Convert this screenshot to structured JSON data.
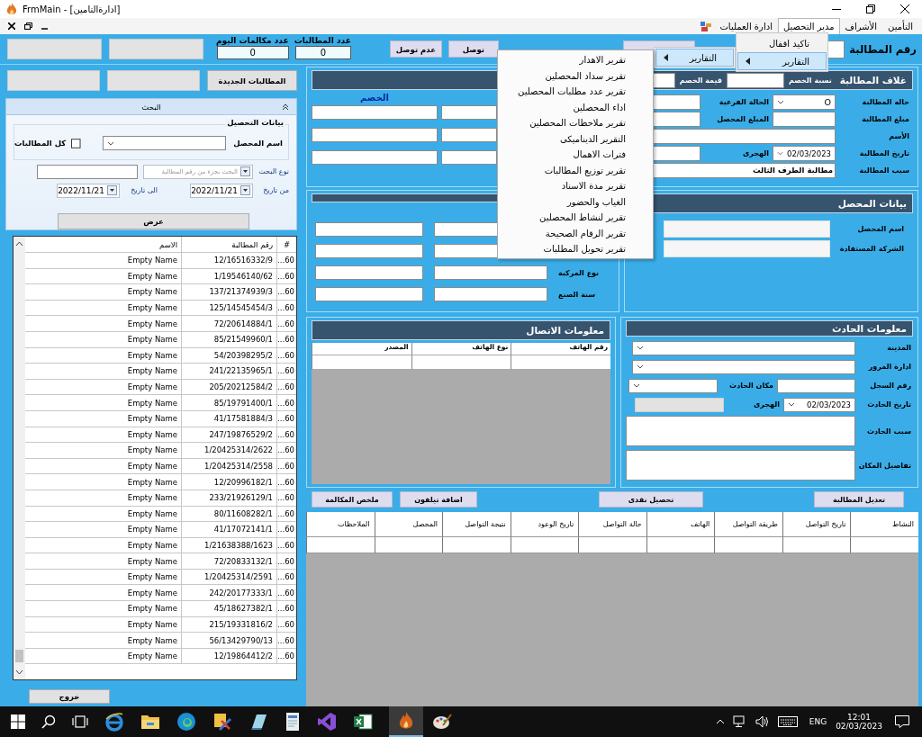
{
  "window": {
    "title": "FrmMain - [ادارةالتامين]"
  },
  "menu_bar": [
    {
      "label": "التأمين",
      "selected": false
    },
    {
      "label": "الأشراف",
      "selected": false
    },
    {
      "label": "مدير التحصيل",
      "selected": true
    },
    {
      "label": "ادارة العمليات",
      "selected": false
    }
  ],
  "dropdown": [
    {
      "label": "تاكيد اقفال",
      "selected": false,
      "submenu": false
    },
    {
      "label": "التقارير",
      "selected": true,
      "submenu": true
    }
  ],
  "submenu": [
    {
      "label": "التقارير",
      "selected": true,
      "submenu": true
    }
  ],
  "reports_menu": [
    "تقرير الاهدار",
    "تقرير سداد المحصلين",
    "تقرير عدد مطلبات المحصلين",
    "اداء المحصلين",
    "تقرير ملاحظات المحصلين",
    "التقرير الديناميكى",
    "فترات الاهمال",
    "تقرير توزيع المطالبات",
    "تقرير مدة الاسناد",
    "الغياب والحضور",
    "تقرير لنشاط المحصلين",
    "تقرير الرقام الصحيحة",
    "تقرير تحويل المطلبات"
  ],
  "top_bar": {
    "counters": [
      {
        "label": "عدد المطالبات",
        "value": "0"
      },
      {
        "label": "عدد مكالمات اليوم",
        "value": "0"
      }
    ],
    "buttons": [
      "توصل",
      "عدم توصل"
    ],
    "claim_number_label": "رقم المطالبة"
  },
  "new_claims_button": "المطالبات الجديدة",
  "search": {
    "title": "البحث",
    "expanded": true,
    "group": "بيانات التحصيل",
    "collector_label": "اسم المحصل",
    "all_claims": {
      "label": "كل المطالبات",
      "checked": false
    },
    "search_type_label": "نوع البحث",
    "search_type_placeholder": "البحث بجزء من رقم المطالبة",
    "from_label": "من تاريخ",
    "from_date": "2022/11/21",
    "to_label": "الى تاريخ",
    "to_date": "2022/11/21",
    "show_button": "عرض"
  },
  "claims_grid": {
    "columns": [
      "#",
      "رقم المطالبة",
      "الاسم"
    ],
    "rows": [
      {
        "index": "...60",
        "number": "12/16516332/9",
        "name": "Empty Name"
      },
      {
        "index": "...60",
        "number": "1/19546140/62",
        "name": "Empty Name"
      },
      {
        "index": "...60",
        "number": "137/21374939/3",
        "name": "Empty Name"
      },
      {
        "index": "...60",
        "number": "125/14545454/3",
        "name": "Empty Name"
      },
      {
        "index": "...60",
        "number": "72/20614884/1",
        "name": "Empty Name"
      },
      {
        "index": "...60",
        "number": "85/21549960/1",
        "name": "Empty Name"
      },
      {
        "index": "...60",
        "number": "54/20398295/2",
        "name": "Empty Name"
      },
      {
        "index": "...60",
        "number": "241/22135965/1",
        "name": "Empty Name"
      },
      {
        "index": "...60",
        "number": "205/20212584/2",
        "name": "Empty Name"
      },
      {
        "index": "...60",
        "number": "85/19791400/1",
        "name": "Empty Name"
      },
      {
        "index": "...60",
        "number": "41/17581884/3",
        "name": "Empty Name"
      },
      {
        "index": "...60",
        "number": "247/19876529/2",
        "name": "Empty Name"
      },
      {
        "index": "...60",
        "number": "1/20425314/2622",
        "name": "Empty Name"
      },
      {
        "index": "...60",
        "number": "1/20425314/2558",
        "name": "Empty Name"
      },
      {
        "index": "...60",
        "number": "12/20996182/1",
        "name": "Empty Name"
      },
      {
        "index": "...60",
        "number": "233/21926129/1",
        "name": "Empty Name"
      },
      {
        "index": "...60",
        "number": "80/11608282/1",
        "name": "Empty Name"
      },
      {
        "index": "...60",
        "number": "41/17072141/1",
        "name": "Empty Name"
      },
      {
        "index": "...60",
        "number": "1/21638388/1623",
        "name": "Empty Name"
      },
      {
        "index": "...60",
        "number": "72/20833132/1",
        "name": "Empty Name"
      },
      {
        "index": "...60",
        "number": "1/20425314/2591",
        "name": "Empty Name"
      },
      {
        "index": "...60",
        "number": "242/20177333/1",
        "name": "Empty Name"
      },
      {
        "index": "...60",
        "number": "45/18627382/1",
        "name": "Empty Name"
      },
      {
        "index": "...60",
        "number": "215/19331816/2",
        "name": "Empty Name"
      },
      {
        "index": "...60",
        "number": "56/13429790/13",
        "name": "Empty Name"
      },
      {
        "index": "...60",
        "number": "12/19864412/2",
        "name": "Empty Name"
      }
    ]
  },
  "exit_button": "خروج",
  "claim_cover": {
    "title": "غلاف المطالبة",
    "discount_fields": [
      "نسبة الخصم",
      "قيمة الخصم"
    ],
    "discount_heading": "الخصم",
    "status_label": "حاله المطالبة",
    "status_value": "O",
    "sub_status_label": "الحالة الفرعية",
    "amount_label": "مبلغ المطالبة",
    "collected_label": "المبلغ المحصل",
    "name_label": "الأسم",
    "date_label": "تاريخ المطالبة",
    "date": "02/03/2023",
    "hijri_label": "الهجرى",
    "reason_label": "سبب المطالبة",
    "reason": "مطالبة الطرف الثالث"
  },
  "vehicle": {
    "labels": [
      "نوع المركبة",
      "سنة الصنع"
    ]
  },
  "collector": {
    "title": "بيانات المحصل",
    "fields": [
      "اسم المحصل",
      "الشركة المستفادة"
    ]
  },
  "contact": {
    "title": "معلومات الاتصال",
    "columns": [
      "رقم الهاتف",
      "نوع الهاتف",
      "المصدر"
    ]
  },
  "accident": {
    "title": "معلومات الحادث",
    "city_label": "المدينة",
    "traffic_label": "ادارة المرور",
    "record_label": "رقم السجل",
    "place_label": "مكان الحادث",
    "date_label": "تاريخ الحادث",
    "date": "02/03/2023",
    "hijri_label": "الهجرى",
    "cause_label": "سبب الحادث",
    "details_label": "تفاصيل المكان"
  },
  "action_buttons": [
    "تعديل المطالبة",
    "تحصيل نقدى",
    "اضافة تيلفون",
    "ملخص المكالمة"
  ],
  "activity_table": {
    "columns": [
      "النشاط",
      "تاريخ التواصل",
      "طريقة التواصل",
      "الهاتف",
      "حالة التواصل",
      "تاريخ الوعود",
      "نتيجة التواصل",
      "المحصل",
      "الملاحظات"
    ]
  },
  "taskbar": {
    "language": "ENG",
    "time": "12:01",
    "date": "02/03/2023"
  }
}
